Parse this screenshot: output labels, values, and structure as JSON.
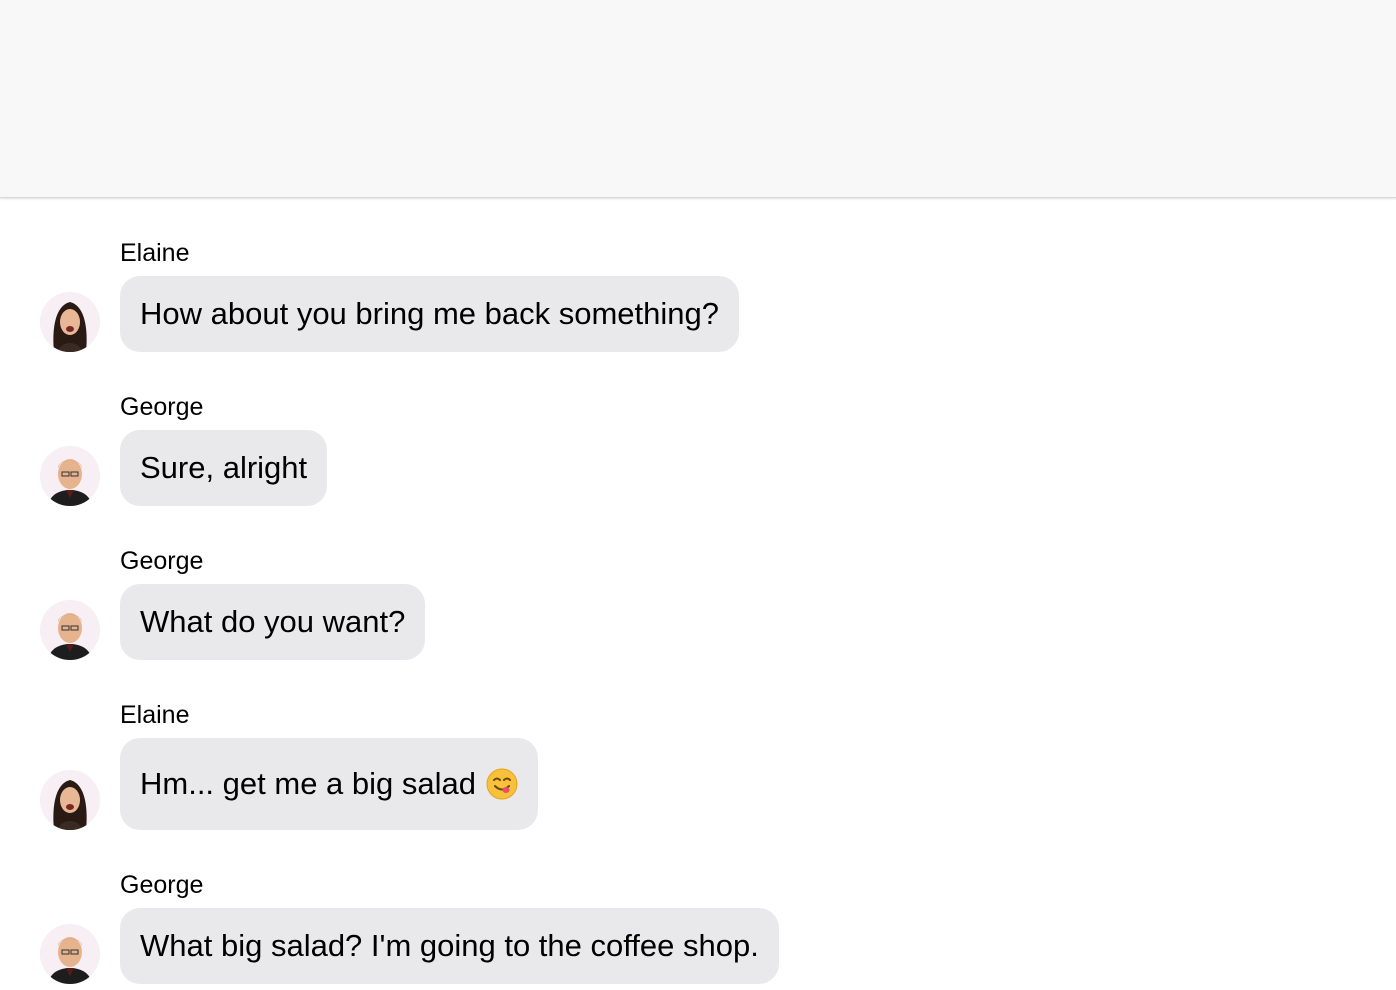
{
  "header": {},
  "messages": [
    {
      "sender": "Elaine",
      "text": "How about you bring me back something?",
      "avatar_icon": "elaine-avatar"
    },
    {
      "sender": "George",
      "text": "Sure, alright",
      "avatar_icon": "george-avatar"
    },
    {
      "sender": "George",
      "text": "What do you want?",
      "avatar_icon": "george-avatar"
    },
    {
      "sender": "Elaine",
      "text": "Hm... get me a big salad",
      "emoji": "yum-face-emoji",
      "avatar_icon": "elaine-avatar"
    },
    {
      "sender": "George",
      "text": "What big salad? I'm going to the coffee shop.",
      "avatar_icon": "george-avatar"
    }
  ],
  "colors": {
    "header_bg": "#f8f8f8",
    "bubble_bg": "#e9e9eb",
    "page_bg": "#ffffff"
  }
}
